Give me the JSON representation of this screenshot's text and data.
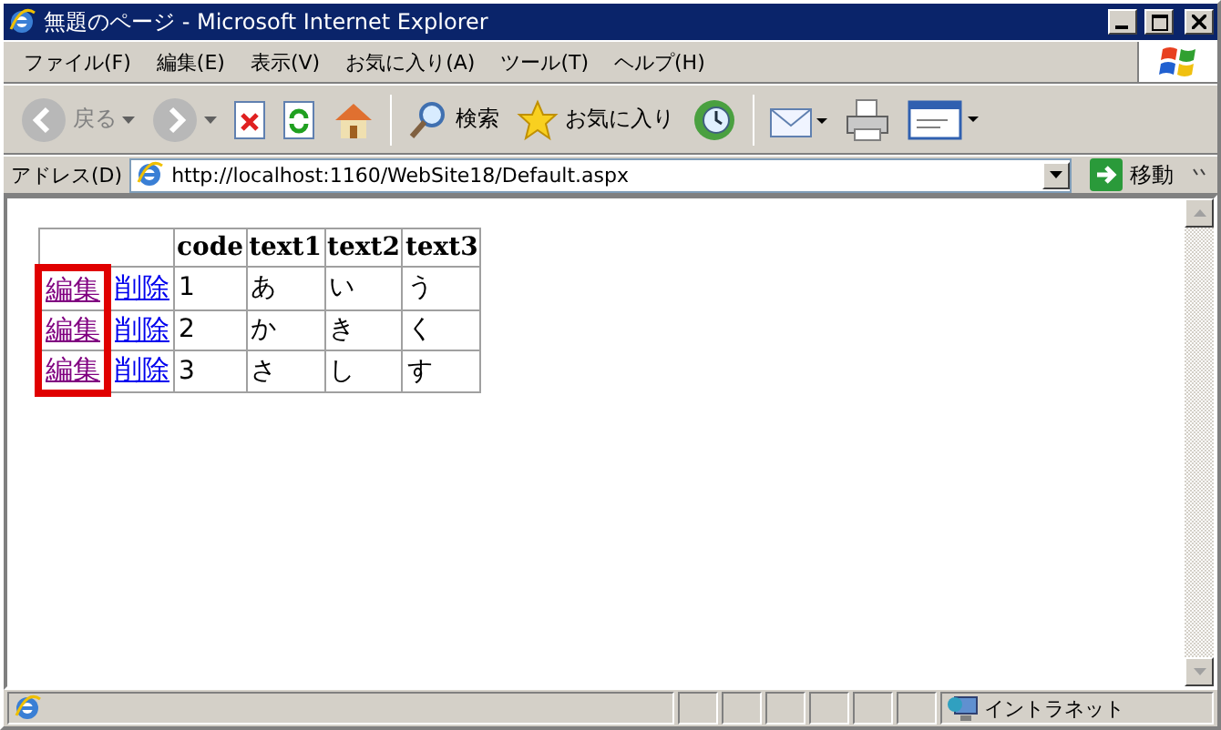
{
  "window": {
    "title": "無題のページ - Microsoft Internet Explorer"
  },
  "menu": [
    "ファイル(F)",
    "編集(E)",
    "表示(V)",
    "お気に入り(A)",
    "ツール(T)",
    "ヘルプ(H)"
  ],
  "toolbar": [
    {
      "kind": "back",
      "label": "戻る",
      "disabled": true
    },
    {
      "kind": "forward",
      "disabled": true
    },
    {
      "kind": "stop"
    },
    {
      "kind": "refresh"
    },
    {
      "kind": "home"
    },
    {
      "kind": "search",
      "label": "検索"
    },
    {
      "kind": "favorites",
      "label": "お気に入り"
    },
    {
      "kind": "history"
    },
    {
      "kind": "mail"
    },
    {
      "kind": "print"
    },
    {
      "kind": "edit"
    }
  ],
  "address_bar": {
    "label": "アドレス(D)",
    "value": "http://localhost:1160/WebSite18/Default.aspx",
    "go_label": "移動"
  },
  "table": {
    "columns": [
      "code",
      "text1",
      "text2",
      "text3"
    ],
    "edit_column_highlighted": true,
    "rows": [
      {
        "edit": "編集",
        "delete": "削除",
        "edit_visited": true,
        "cells": [
          "1",
          "あ",
          "い",
          "う"
        ]
      },
      {
        "edit": "編集",
        "delete": "削除",
        "edit_visited": true,
        "cells": [
          "2",
          "か",
          "き",
          "く"
        ]
      },
      {
        "edit": "編集",
        "delete": "削除",
        "edit_visited": true,
        "cells": [
          "3",
          "さ",
          "し",
          "す"
        ]
      }
    ]
  },
  "status_bar": {
    "zone": "イントラネット"
  }
}
